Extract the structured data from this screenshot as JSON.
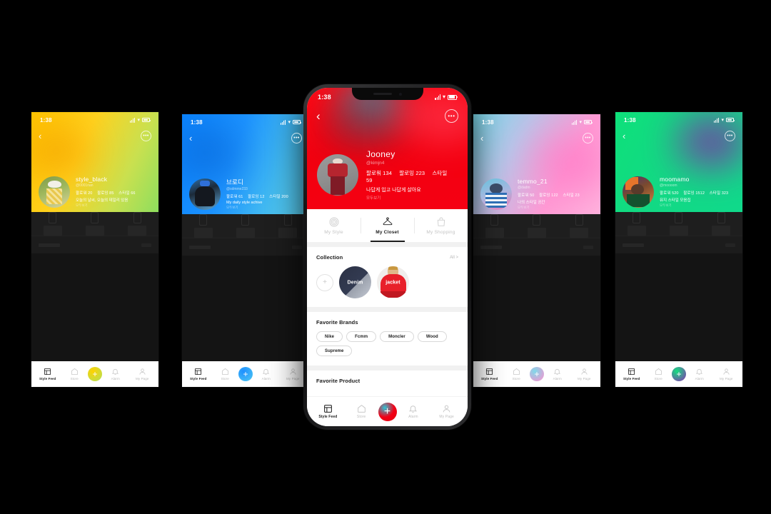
{
  "status_bar": {
    "time": "1:38",
    "icons": [
      "signal-icon",
      "wifi-icon",
      "battery-icon"
    ]
  },
  "center_phone": {
    "theme_color": "#f50013",
    "back_icon": "chevron-left-icon",
    "more_icon": "ellipsis-icon",
    "profile": {
      "name": "Jooney",
      "handle": "@kimjn4",
      "followers_label": "팔로워 134",
      "following_label": "팔로잉 223",
      "styles_label": "스타일 59",
      "bio": "나답게 입고 나답게 살아요",
      "more_link": "모두보기"
    },
    "tabs": [
      {
        "label": "My Style",
        "icon": "target-icon",
        "active": false
      },
      {
        "label": "My Closet",
        "icon": "hanger-icon",
        "active": true
      },
      {
        "label": "My Shopping",
        "icon": "bag-icon",
        "active": false
      }
    ],
    "collection": {
      "title": "Collection",
      "all_label": "All >",
      "add_icon": "plus-icon",
      "items": [
        {
          "label": "Denim",
          "color": "#2b3144"
        },
        {
          "label": "jacket",
          "color": "#e8202a"
        }
      ]
    },
    "favorite_brands": {
      "title": "Favorite Brands",
      "items": [
        "Nike",
        "Fcmm",
        "Moncler",
        "Wood",
        "Supreme"
      ]
    },
    "favorite_product": {
      "title": "Favorite Product"
    },
    "bottom_nav": [
      {
        "label": "Style Feed",
        "icon": "layout-icon",
        "active": true
      },
      {
        "label": "Store",
        "icon": "home-icon",
        "active": false
      },
      {
        "label": "",
        "icon": "plus-fab-icon",
        "active": false,
        "fab": true
      },
      {
        "label": "Alarm",
        "icon": "bell-icon",
        "active": false
      },
      {
        "label": "My Page",
        "icon": "person-icon",
        "active": false
      }
    ]
  },
  "side_phones": [
    {
      "id": "yellow",
      "gradient_from": "#ffc400",
      "gradient_to": "#8ede5e",
      "blob_color": "#f7a800",
      "fab_gradient_from": "#ffd200",
      "fab_gradient_to": "#b2e05a",
      "avatar_from": "#7e9b4a",
      "avatar_to": "#d8d3a0",
      "profile": {
        "name": "style_black",
        "handle": "@0001nan",
        "followers_label": "팔로워 20",
        "following_label": "팔로잉 85",
        "styles_label": "스타일 66",
        "bio": "오늘의 날씨, 오늘의 데일리 있음",
        "more_link": "모두보기"
      }
    },
    {
      "id": "blue",
      "gradient_from": "#0a84ff",
      "gradient_to": "#5fd6f5",
      "blob_color": "#0b6fe0",
      "fab_gradient_from": "#1e8fff",
      "fab_gradient_to": "#4fc9f2",
      "avatar_from": "#1c2b3a",
      "avatar_to": "#5fa8d8",
      "profile": {
        "name": "브로디",
        "handle": "@sdmme233",
        "followers_label": "팔로워 61",
        "following_label": "팔로잉 12",
        "styles_label": "스타일 200",
        "bio": "My daily style achive",
        "more_link": "모두보기"
      }
    },
    {
      "id": "pink",
      "gradient_from": "#78d7e8",
      "gradient_to": "#ff8fd0",
      "blob_color": "#ff7ec8",
      "fab_gradient_from": "#7fd9ea",
      "fab_gradient_to": "#ff90cf",
      "avatar_from": "#4fa8cf",
      "avatar_to": "#ef7ab8",
      "profile": {
        "name": "temmo_21",
        "handle": "@dadm",
        "followers_label": "팔로워 50",
        "following_label": "팔로잉 122",
        "styles_label": "스타일 23",
        "bio": "나의 스타일 공간",
        "more_link": "모두보기"
      }
    },
    {
      "id": "green",
      "gradient_from": "#0ee07a",
      "gradient_to": "#10d98b",
      "blob_color": "#7d2ea8",
      "fab_gradient_from": "#13e07f",
      "fab_gradient_to": "#8a2fb5",
      "avatar_from": "#46307a",
      "avatar_to": "#d9833f",
      "profile": {
        "name": "moomamo",
        "handle": "@moooom",
        "followers_label": "팔로워 520",
        "following_label": "팔로잉 1512",
        "styles_label": "스타일 323",
        "bio": "뮤지 스타일 모음집",
        "more_link": "모두보기"
      }
    }
  ],
  "side_nav_labels": [
    "Style Feed",
    "Store",
    "Alarm",
    "My Page"
  ]
}
